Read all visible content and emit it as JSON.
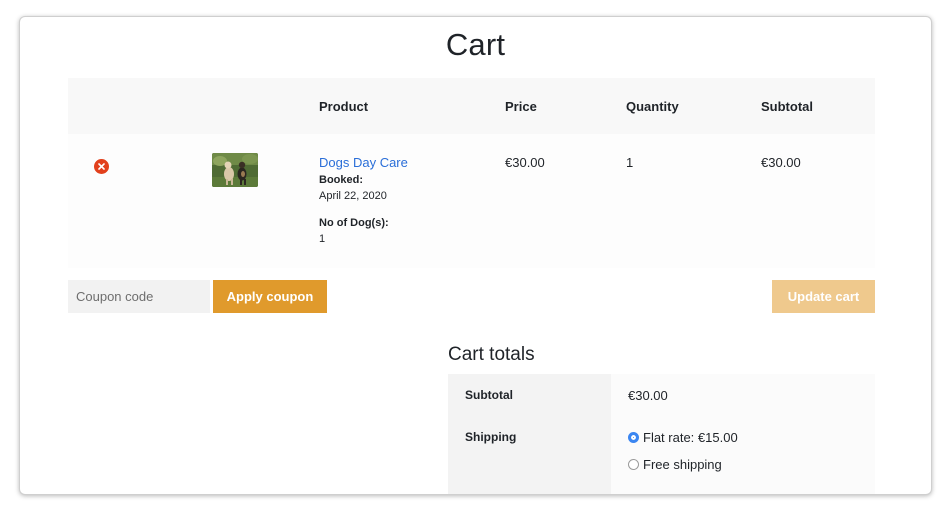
{
  "page": {
    "title": "Cart"
  },
  "table": {
    "headers": {
      "product": "Product",
      "price": "Price",
      "quantity": "Quantity",
      "subtotal": "Subtotal"
    },
    "items": [
      {
        "name": "Dogs Day Care",
        "booked_label": "Booked:",
        "booked_value": "April 22, 2020",
        "dogs_label": "No of Dog(s):",
        "dogs_value": "1",
        "price": "€30.00",
        "quantity": "1",
        "subtotal": "€30.00"
      }
    ]
  },
  "actions": {
    "coupon_placeholder": "Coupon code",
    "apply_label": "Apply coupon",
    "update_label": "Update cart"
  },
  "totals": {
    "title": "Cart totals",
    "subtotal_label": "Subtotal",
    "subtotal_value": "€30.00",
    "shipping_label": "Shipping",
    "shipping_options": [
      {
        "label": "Flat rate: €15.00",
        "selected": true
      },
      {
        "label": "Free shipping",
        "selected": false
      }
    ]
  },
  "colors": {
    "accent": "#e09a2c",
    "accent_disabled": "#efc98d",
    "link": "#2a6ed8",
    "remove": "#e2401c",
    "radio_selected": "#3b86f1"
  },
  "icons": {
    "remove": "close-circle-icon",
    "thumbnail": "dogs-photo"
  }
}
